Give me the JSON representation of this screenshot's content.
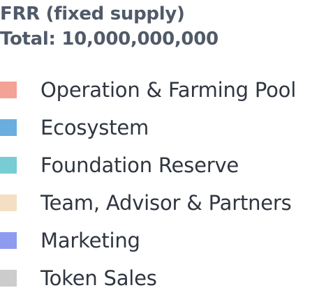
{
  "header": {
    "title_line1": "FRR (fixed supply)",
    "title_line2": "Total: 10,000,000,000"
  },
  "legend": {
    "items": [
      {
        "label": "Operation & Farming Pool",
        "color": "#f4a196"
      },
      {
        "label": "Ecosystem",
        "color": "#6aaee0"
      },
      {
        "label": "Foundation Reserve",
        "color": "#78ccd3"
      },
      {
        "label": "Team, Advisor & Partners",
        "color": "#f5dfc4"
      },
      {
        "label": "Marketing",
        "color": "#8f9bee"
      },
      {
        "label": "Token Sales",
        "color": "#cccccc"
      }
    ]
  }
}
